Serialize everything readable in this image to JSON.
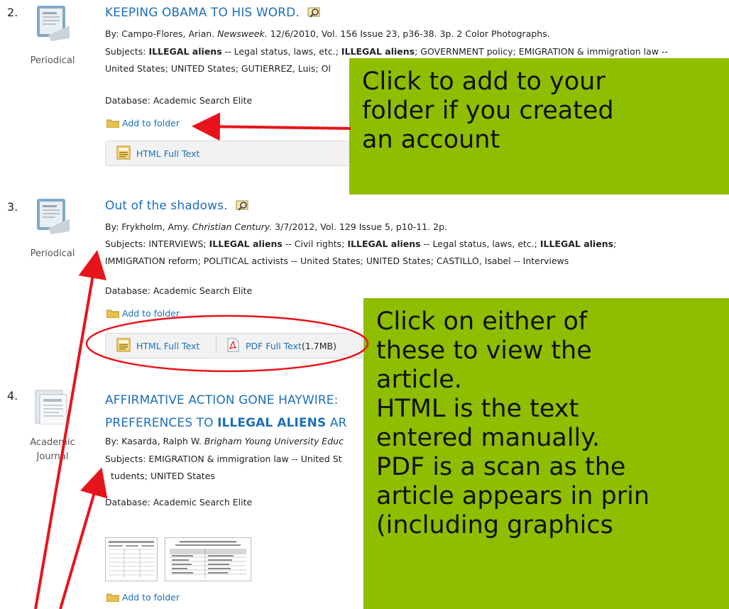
{
  "results": [
    {
      "number": "2.",
      "type": "Periodical",
      "title": "KEEPING OBAMA TO HIS WORD.",
      "byline": "By: Campo-Flores, Arian. ",
      "source": "Newsweek.",
      "citation": " 12/6/2010, Vol. 156 Issue 23, p36-38. 3p. 2 Color Photographs.",
      "subjects_line1": "Subjects: <b>ILLEGAL aliens</b> -- Legal status, laws, etc.; <b>ILLEGAL aliens</b>; GOVERNMENT policy; EMIGRATION &amp; immigration law --",
      "subjects_line2": "United States; UNITED States; GUTIERREZ, Luis; Ol",
      "database": "Database: Academic Search Elite",
      "add_to_folder": "Add to folder",
      "html_full_text": "HTML Full Text"
    },
    {
      "number": "3.",
      "type": "Periodical",
      "title": "Out of the shadows.",
      "byline": "By: Frykholm, Amy. ",
      "source": "Christian Century.",
      "citation": " 3/7/2012, Vol. 129 Issue 5, p10-11. 2p.",
      "subjects_line1": "Subjects: INTERVIEWS; <b>ILLEGAL aliens</b> -- Civil rights; <b>ILLEGAL aliens</b> -- Legal status, laws, etc.; <b>ILLEGAL aliens</b>;",
      "subjects_line2": "IMMIGRATION reform; POLITICAL activists -- United States; UNITED States; CASTILLO, Isabel -- Interviews",
      "database": "Database: Academic Search Elite",
      "add_to_folder": "Add to folder",
      "html_full_text": "HTML Full Text",
      "pdf_full_text": "PDF Full Text",
      "pdf_size": "(1.7MB)"
    },
    {
      "number": "4.",
      "type_line1": "Academic",
      "type_line2": "Journal",
      "title_line1": "AFFIRMATIVE ACTION GONE HAYWIRE:",
      "title_line2_pre": "PREFERENCES TO ",
      "title_line2_bold": "ILLEGAL ALIENS",
      "title_line2_post": " AR",
      "byline": "By: Kasarda, Ralph W. ",
      "source": "Brigham Young University Educ",
      "subjects_line1": "Subjects: EMIGRATION &amp; immigration law -- United St",
      "subjects_line2": "tudents; UNITED States",
      "database": "Database: Academic Search Elite",
      "add_to_folder": "Add to folder"
    }
  ],
  "callouts": {
    "folder": [
      "Click to add to your",
      "folder if you created",
      "an account"
    ],
    "fulltext": [
      "Click on either of",
      "these to view the",
      "article.",
      "HTML is the text",
      "entered manually.",
      "PDF is a scan as the",
      "article appears in prin",
      "(including graphics"
    ]
  },
  "colors": {
    "callout_bg": "#8fbe00",
    "arrow": "#e8141b",
    "link": "#1d6fb8"
  }
}
